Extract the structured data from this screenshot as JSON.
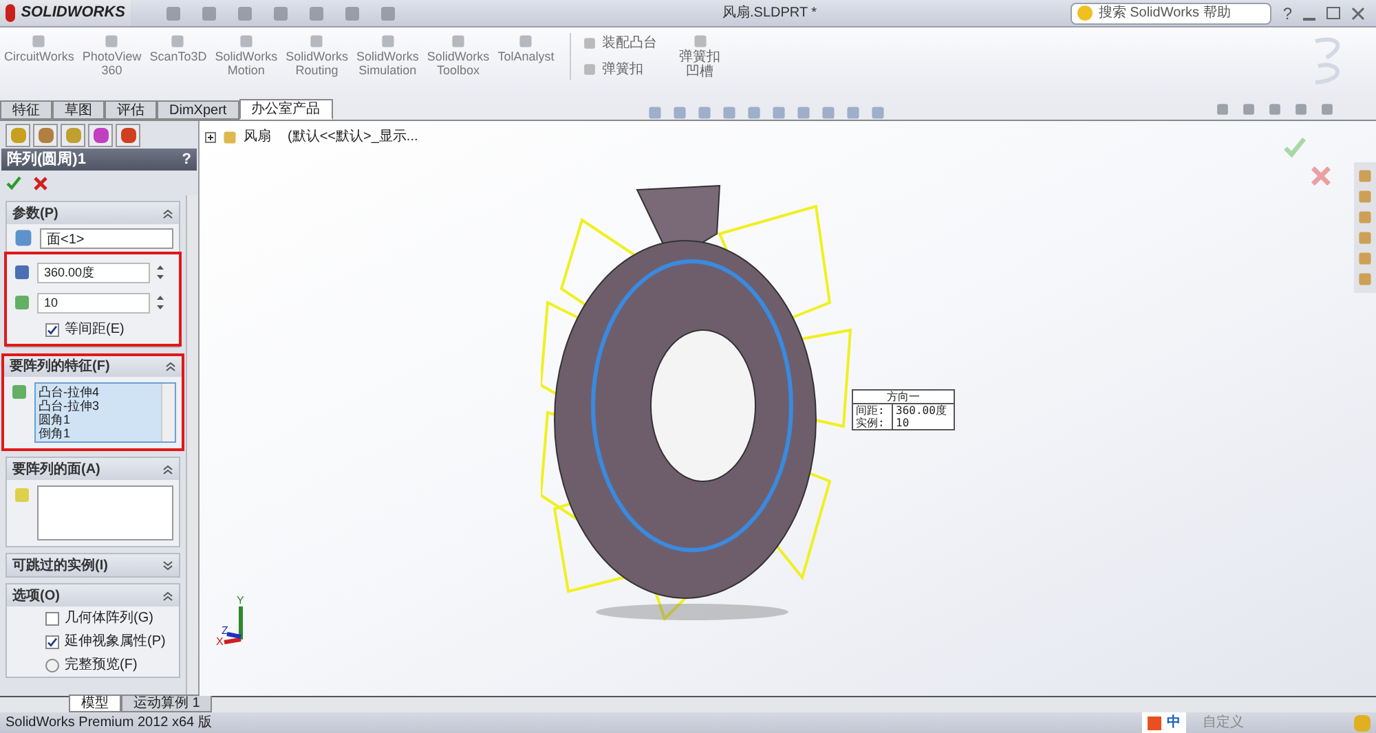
{
  "title_bar": {
    "app": "SOLIDWORKS",
    "document": "风扇.SLDPRT *",
    "search_placeholder": "搜索 SolidWorks 帮助",
    "help": "?"
  },
  "ribbon": {
    "addins": [
      {
        "lines": [
          "CircuitWorks"
        ]
      },
      {
        "lines": [
          "PhotoView",
          "360"
        ]
      },
      {
        "lines": [
          "ScanTo3D"
        ]
      },
      {
        "lines": [
          "SolidWorks",
          "Motion"
        ]
      },
      {
        "lines": [
          "SolidWorks",
          "Routing"
        ]
      },
      {
        "lines": [
          "SolidWorks",
          "Simulation"
        ]
      },
      {
        "lines": [
          "SolidWorks",
          "Toolbox"
        ]
      },
      {
        "lines": [
          "TolAnalyst"
        ]
      }
    ],
    "small_commands": [
      "装配凸台",
      "弹簧扣"
    ],
    "large_command": [
      "弹簧扣",
      "凹槽"
    ]
  },
  "command_tabs": [
    {
      "label": "特征",
      "selected": false
    },
    {
      "label": "草图",
      "selected": false
    },
    {
      "label": "评估",
      "selected": false
    },
    {
      "label": "DimXpert",
      "selected": false
    },
    {
      "label": "办公室产品",
      "selected": true
    }
  ],
  "property_manager": {
    "title": "阵列(圆周)1",
    "help": "?",
    "parameters": {
      "title": "参数(P)",
      "axis": "面<1>",
      "angle": "360.00度",
      "instances": "10",
      "equal_spacing": {
        "label": "等间距(E)",
        "checked": true
      }
    },
    "features": {
      "title": "要阵列的特征(F)",
      "items": [
        "凸台-拉伸4",
        "凸台-拉伸3",
        "圆角1",
        "倒角1"
      ]
    },
    "faces": {
      "title": "要阵列的面(A)"
    },
    "skip": {
      "title": "可跳过的实例(I)",
      "expanded": false
    },
    "options": {
      "title": "选项(O)",
      "items": [
        {
          "kind": "checkbox",
          "label": "几何体阵列(G)",
          "checked": false
        },
        {
          "kind": "checkbox",
          "label": "延伸视象属性(P)",
          "checked": true
        },
        {
          "kind": "radio",
          "label": "完整预览(F)",
          "checked": false
        }
      ]
    }
  },
  "tree": {
    "name": "风扇",
    "config": "(默认<<默认>_显示..."
  },
  "callout": {
    "title": "方向一",
    "rows": [
      {
        "label": "间距:",
        "value": "360.00度"
      },
      {
        "label": "实例:",
        "value": "10"
      }
    ]
  },
  "triad": [
    "Y",
    "Z",
    "X"
  ],
  "bottom_tabs": [
    {
      "label": "模型",
      "selected": true
    },
    {
      "label": "运动算例 1",
      "selected": false
    }
  ],
  "status_bar": {
    "text": "SolidWorks Premium 2012 x64 版",
    "ime": "中",
    "customize": "自定义"
  }
}
